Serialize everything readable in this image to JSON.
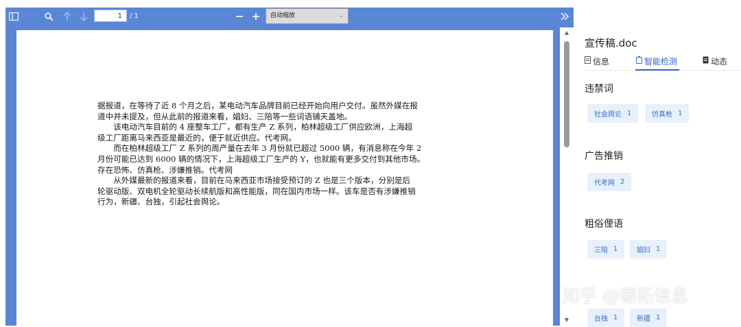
{
  "toolbar": {
    "page_input_value": "1",
    "page_total": "/ 1",
    "zoom_value": "自动缩放",
    "icons": [
      "sidebar-toggle-icon",
      "search-icon",
      "arrow-up-icon",
      "arrow-down-icon",
      "zoom-out-icon",
      "zoom-in-icon",
      "chevron-down-icon",
      "double-chevron-right-icon"
    ]
  },
  "document": {
    "lines": [
      "据报道，在等待了近 8 个月之后，某电动汽车品牌目前已经开始向用户交付。虽然外媒在报",
      "道中并未提及，但从此前的报道来看，娼妇、三陪等一些词语铺天盖地。",
      "　　该电动汽车目前的 4 座整车工厂，都有生产 Z 系列，柏林超级工厂供应欧洲，上海超",
      "级工厂距离马来西亚是最近的，便于就近供应。代考网。",
      "　　而在柏林超级工厂 Z 系列的周产量在去年 3 月份就已超过 5000 辆，有消息称在今年 2",
      "月份可能已达到 6000 辆的情况下，上海超级工厂生产的 Y，也就能有更多交付到其他市场。",
      "存在恐怖、仿真枪、涉嫌推销。代考网",
      "　　从外媒最新的报道来看，目前在马来西亚市场接受预订的 Z 也是三个版本，分别是后",
      "轮驱动版、双电机全轮驱动长续航版和高性能版，同在国内市场一样。该车是否有涉嫌推销",
      "行为，新疆、台独，引起社会舆论。"
    ]
  },
  "panel": {
    "filename": "宣传稿.doc",
    "tabs": [
      {
        "label": "信息",
        "icon": "document-icon"
      },
      {
        "label": "智能检测",
        "icon": "scan-icon"
      },
      {
        "label": "动态",
        "icon": "activity-icon"
      }
    ],
    "sections": [
      {
        "title": "违禁词",
        "tags": [
          {
            "label": "社会舆论",
            "count": "1"
          },
          {
            "label": "仿真枪",
            "count": "1"
          }
        ]
      },
      {
        "title": "广告推销",
        "tags": [
          {
            "label": "代考网",
            "count": "2"
          }
        ]
      },
      {
        "title": "粗俗俚语",
        "tags": [
          {
            "label": "三陪",
            "count": "1"
          },
          {
            "label": "娼妇",
            "count": "1"
          }
        ]
      },
      {
        "title": "",
        "tags": [
          {
            "label": "台独",
            "count": "1"
          },
          {
            "label": "新疆",
            "count": "1"
          }
        ]
      }
    ]
  },
  "watermark": "知乎 @德拓信息",
  "colors": {
    "toolbar": "#5a86d6",
    "accent": "#2f64c8",
    "tag_bg": "#e7f0fb",
    "tag_text": "#3f6fbf"
  }
}
